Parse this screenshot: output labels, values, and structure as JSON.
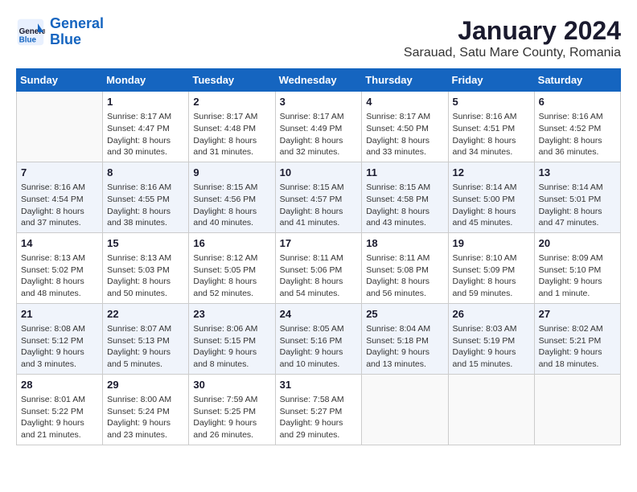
{
  "logo": {
    "text_general": "General",
    "text_blue": "Blue"
  },
  "title": "January 2024",
  "subtitle": "Sarauad, Satu Mare County, Romania",
  "days_of_week": [
    "Sunday",
    "Monday",
    "Tuesday",
    "Wednesday",
    "Thursday",
    "Friday",
    "Saturday"
  ],
  "weeks": [
    [
      {
        "day": "",
        "info": ""
      },
      {
        "day": "1",
        "info": "Sunrise: 8:17 AM\nSunset: 4:47 PM\nDaylight: 8 hours\nand 30 minutes."
      },
      {
        "day": "2",
        "info": "Sunrise: 8:17 AM\nSunset: 4:48 PM\nDaylight: 8 hours\nand 31 minutes."
      },
      {
        "day": "3",
        "info": "Sunrise: 8:17 AM\nSunset: 4:49 PM\nDaylight: 8 hours\nand 32 minutes."
      },
      {
        "day": "4",
        "info": "Sunrise: 8:17 AM\nSunset: 4:50 PM\nDaylight: 8 hours\nand 33 minutes."
      },
      {
        "day": "5",
        "info": "Sunrise: 8:16 AM\nSunset: 4:51 PM\nDaylight: 8 hours\nand 34 minutes."
      },
      {
        "day": "6",
        "info": "Sunrise: 8:16 AM\nSunset: 4:52 PM\nDaylight: 8 hours\nand 36 minutes."
      }
    ],
    [
      {
        "day": "7",
        "info": "Sunrise: 8:16 AM\nSunset: 4:54 PM\nDaylight: 8 hours\nand 37 minutes."
      },
      {
        "day": "8",
        "info": "Sunrise: 8:16 AM\nSunset: 4:55 PM\nDaylight: 8 hours\nand 38 minutes."
      },
      {
        "day": "9",
        "info": "Sunrise: 8:15 AM\nSunset: 4:56 PM\nDaylight: 8 hours\nand 40 minutes."
      },
      {
        "day": "10",
        "info": "Sunrise: 8:15 AM\nSunset: 4:57 PM\nDaylight: 8 hours\nand 41 minutes."
      },
      {
        "day": "11",
        "info": "Sunrise: 8:15 AM\nSunset: 4:58 PM\nDaylight: 8 hours\nand 43 minutes."
      },
      {
        "day": "12",
        "info": "Sunrise: 8:14 AM\nSunset: 5:00 PM\nDaylight: 8 hours\nand 45 minutes."
      },
      {
        "day": "13",
        "info": "Sunrise: 8:14 AM\nSunset: 5:01 PM\nDaylight: 8 hours\nand 47 minutes."
      }
    ],
    [
      {
        "day": "14",
        "info": "Sunrise: 8:13 AM\nSunset: 5:02 PM\nDaylight: 8 hours\nand 48 minutes."
      },
      {
        "day": "15",
        "info": "Sunrise: 8:13 AM\nSunset: 5:03 PM\nDaylight: 8 hours\nand 50 minutes."
      },
      {
        "day": "16",
        "info": "Sunrise: 8:12 AM\nSunset: 5:05 PM\nDaylight: 8 hours\nand 52 minutes."
      },
      {
        "day": "17",
        "info": "Sunrise: 8:11 AM\nSunset: 5:06 PM\nDaylight: 8 hours\nand 54 minutes."
      },
      {
        "day": "18",
        "info": "Sunrise: 8:11 AM\nSunset: 5:08 PM\nDaylight: 8 hours\nand 56 minutes."
      },
      {
        "day": "19",
        "info": "Sunrise: 8:10 AM\nSunset: 5:09 PM\nDaylight: 8 hours\nand 59 minutes."
      },
      {
        "day": "20",
        "info": "Sunrise: 8:09 AM\nSunset: 5:10 PM\nDaylight: 9 hours\nand 1 minute."
      }
    ],
    [
      {
        "day": "21",
        "info": "Sunrise: 8:08 AM\nSunset: 5:12 PM\nDaylight: 9 hours\nand 3 minutes."
      },
      {
        "day": "22",
        "info": "Sunrise: 8:07 AM\nSunset: 5:13 PM\nDaylight: 9 hours\nand 5 minutes."
      },
      {
        "day": "23",
        "info": "Sunrise: 8:06 AM\nSunset: 5:15 PM\nDaylight: 9 hours\nand 8 minutes."
      },
      {
        "day": "24",
        "info": "Sunrise: 8:05 AM\nSunset: 5:16 PM\nDaylight: 9 hours\nand 10 minutes."
      },
      {
        "day": "25",
        "info": "Sunrise: 8:04 AM\nSunset: 5:18 PM\nDaylight: 9 hours\nand 13 minutes."
      },
      {
        "day": "26",
        "info": "Sunrise: 8:03 AM\nSunset: 5:19 PM\nDaylight: 9 hours\nand 15 minutes."
      },
      {
        "day": "27",
        "info": "Sunrise: 8:02 AM\nSunset: 5:21 PM\nDaylight: 9 hours\nand 18 minutes."
      }
    ],
    [
      {
        "day": "28",
        "info": "Sunrise: 8:01 AM\nSunset: 5:22 PM\nDaylight: 9 hours\nand 21 minutes."
      },
      {
        "day": "29",
        "info": "Sunrise: 8:00 AM\nSunset: 5:24 PM\nDaylight: 9 hours\nand 23 minutes."
      },
      {
        "day": "30",
        "info": "Sunrise: 7:59 AM\nSunset: 5:25 PM\nDaylight: 9 hours\nand 26 minutes."
      },
      {
        "day": "31",
        "info": "Sunrise: 7:58 AM\nSunset: 5:27 PM\nDaylight: 9 hours\nand 29 minutes."
      },
      {
        "day": "",
        "info": ""
      },
      {
        "day": "",
        "info": ""
      },
      {
        "day": "",
        "info": ""
      }
    ]
  ]
}
